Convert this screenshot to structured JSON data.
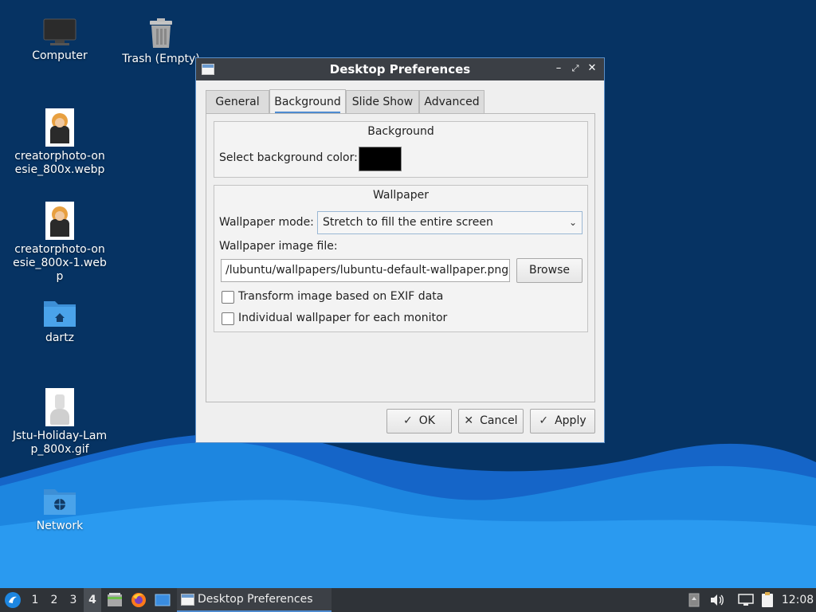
{
  "desktop": {
    "icons": [
      {
        "label": "Computer"
      },
      {
        "label": "Trash (Empty)"
      },
      {
        "label": "creatorphoto-onesie_800x.webp"
      },
      {
        "label": "creatorphoto-onesie_800x-1.webp"
      },
      {
        "label": "dartz"
      },
      {
        "label": "Jstu-Holiday-Lamp_800x.gif"
      },
      {
        "label": "Network"
      }
    ]
  },
  "dialog": {
    "title": "Desktop Preferences",
    "tabs": [
      {
        "label": "General"
      },
      {
        "label": "Background"
      },
      {
        "label": "Slide Show"
      },
      {
        "label": "Advanced"
      }
    ],
    "active_tab": "Background",
    "background_group": {
      "title": "Background",
      "color_label": "Select background color:",
      "color_value": "#000000"
    },
    "wallpaper_group": {
      "title": "Wallpaper",
      "mode_label": "Wallpaper mode:",
      "mode_value": "Stretch to fill the entire screen",
      "file_label": "Wallpaper image file:",
      "file_value": "/lubuntu/wallpapers/lubuntu-default-wallpaper.png",
      "browse_label": "Browse",
      "exif_label": "Transform image based on EXIF data",
      "exif_checked": false,
      "individual_label": "Individual wallpaper for each monitor",
      "individual_checked": false
    },
    "buttons": {
      "ok": "OK",
      "cancel": "Cancel",
      "apply": "Apply"
    }
  },
  "taskbar": {
    "desktops": [
      "1",
      "2",
      "3",
      "4"
    ],
    "active_desktop": "4",
    "task_label": "Desktop Preferences",
    "clock": "12:08"
  },
  "colors": {
    "desktop_bg": "#063363",
    "wave_light": "#1e90e6",
    "titlebar": "#3b3f45",
    "accent": "#4e8bd0",
    "taskbar": "#2f3338"
  }
}
